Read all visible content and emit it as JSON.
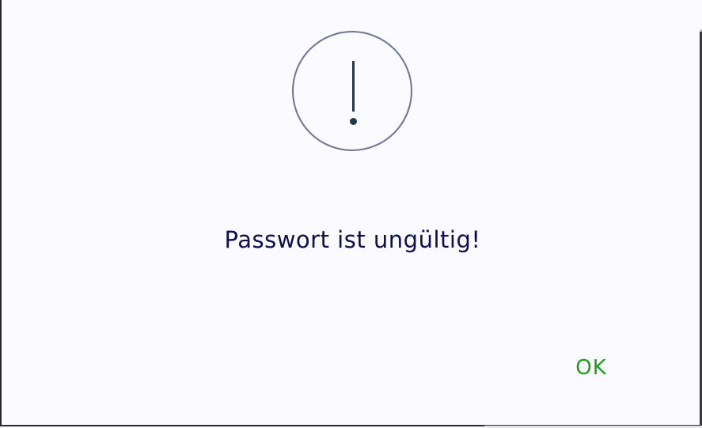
{
  "dialog": {
    "icon": "exclamation-icon",
    "message": "Passwort ist ungültig!",
    "ok_label": "OK"
  },
  "colors": {
    "background": "#fbfafe",
    "icon_circle": "#6c7398",
    "icon_glyph": "#1f3a4f",
    "message_text": "#0d0d50",
    "ok_text": "#1e9a1e"
  }
}
